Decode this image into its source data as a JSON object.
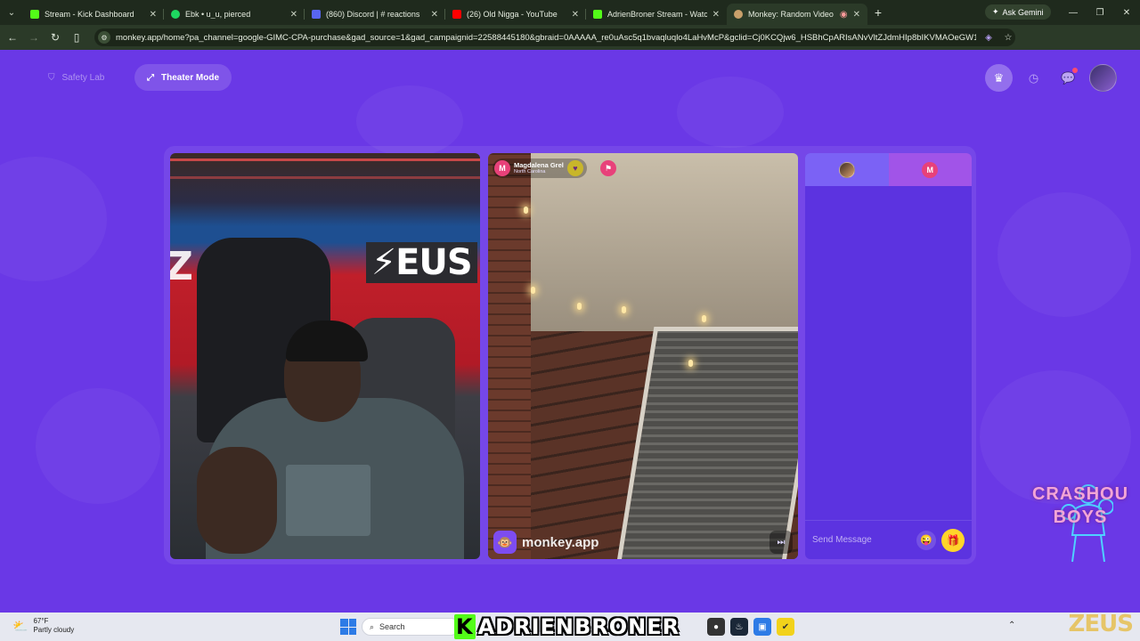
{
  "browser": {
    "tabs": [
      {
        "title": "Stream - Kick Dashboard",
        "color": "#53fc18",
        "active": false
      },
      {
        "title": "Ebk • u_u, pierced",
        "color": "#1ed760",
        "active": false
      },
      {
        "title": "(860) Discord | # reactions",
        "color": "#5865f2",
        "active": false
      },
      {
        "title": "(26) Old Nigga - YouTube",
        "color": "#ff0000",
        "active": false
      },
      {
        "title": "AdrienBroner Stream - Watch L",
        "color": "#53fc18",
        "active": false
      },
      {
        "title": "Monkey: Random Video Ch",
        "color": "#c9a06b",
        "active": true
      }
    ],
    "ask_gemini": "Ask Gemini",
    "url": "monkey.app/home?pa_channel=google-GIMC-CPA-purchase&gad_source=1&gad_campaignid=22588445180&gbraid=0AAAAA_re0uAsc5q1bvaqluqlo4LaHvMcP&gclid=Cj0KCQjw6_HSBhCpARIsANvVltZJdmHIp8bIKVMAOeGW17G..."
  },
  "page": {
    "safety_lab": "Safety Lab",
    "theater_mode": "Theater Mode"
  },
  "partner": {
    "initial": "M",
    "name": "Magdalena Grel",
    "location": "North Carolina"
  },
  "watermark": "monkey.app",
  "chat": {
    "tab2_initial": "M",
    "placeholder": "Send Message"
  },
  "overlay": {
    "crash_line1": "CRASHOU",
    "crash_line2": "BOYS",
    "zeus": "ZEUS",
    "banner": "ADRIENBRONER",
    "banner_k": "K",
    "banner_brand_color": "#53fc18"
  },
  "taskbar": {
    "temp": "67°F",
    "condition": "Partly cloudy",
    "search": "Search"
  },
  "colors": {
    "page_bg": "#6a38e6",
    "accent_pink": "#e8417a",
    "gift_yellow": "#ffd52a"
  }
}
